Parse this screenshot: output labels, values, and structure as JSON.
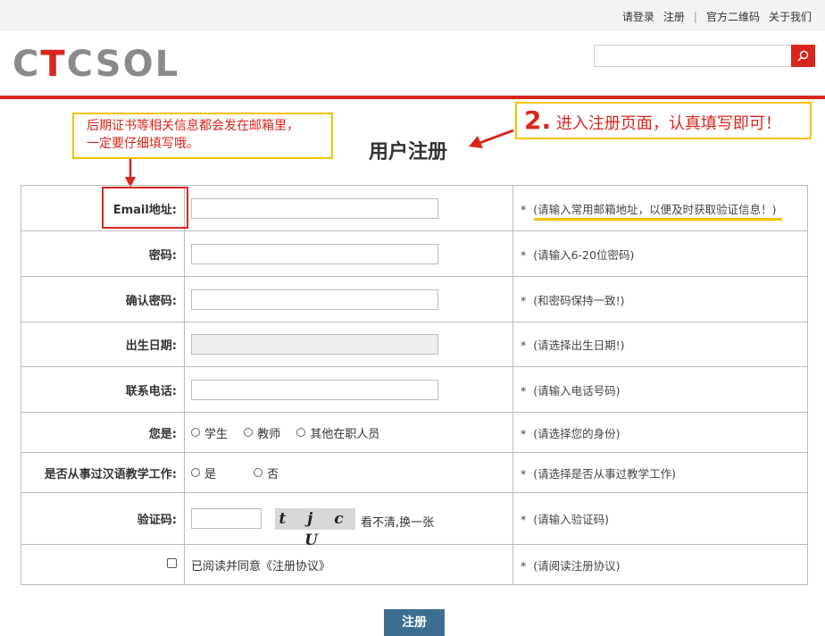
{
  "topbar": {
    "login": "请登录",
    "register": "注册",
    "separator": "|",
    "qrcode": "官方二维码",
    "about": "关于我们"
  },
  "logo": {
    "part1": "C",
    "part2": "T",
    "part3": "CSOL"
  },
  "search": {
    "placeholder": ""
  },
  "annotations": {
    "note1_line1": "后期证书等相关信息都会发在邮箱里，",
    "note1_line2": "一定要仔细填写哦。",
    "note2_num": "2.",
    "note2_text": " 进入注册页面，认真填写即可！"
  },
  "page_title": "用户注册",
  "form": {
    "email_label": "Email地址:",
    "email_tip": "(请输入常用邮箱地址，以便及时获取验证信息！)",
    "password_label": "密码:",
    "password_tip": "(请输入6-20位密码)",
    "confirm_label": "确认密码:",
    "confirm_tip": "(和密码保持一致!)",
    "birth_label": "出生日期:",
    "birth_tip": "(请选择出生日期!)",
    "phone_label": "联系电话:",
    "phone_tip": "(请输入电话号码)",
    "role_label": "您是:",
    "role_options": [
      "学生",
      "教师",
      "其他在职人员"
    ],
    "role_tip": "(请选择您的身份)",
    "teach_label": "是否从事过汉语教学工作:",
    "teach_options": [
      "是",
      "否"
    ],
    "teach_tip": "(请选择是否从事过教学工作)",
    "captcha_label": "验证码:",
    "captcha_text": "t j c U",
    "captcha_change": "看不清,换一张",
    "captcha_tip": "(请输入验证码)",
    "agree_text": "已阅读并同意《注册协议》",
    "agree_tip": "(请阅读注册协议)",
    "required_mark": "*"
  },
  "submit_label": "注册",
  "colors": {
    "brand_red": "#d9261c",
    "highlight_yellow": "#f2c200",
    "submit_blue": "#3c6e91"
  }
}
